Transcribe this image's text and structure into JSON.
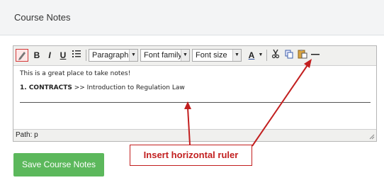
{
  "panel": {
    "title": "Course Notes"
  },
  "toolbar": {
    "bold": "B",
    "italic": "I",
    "underline": "U",
    "format_select": "Paragraph",
    "font_family_select": "Font family",
    "font_size_select": "Font size",
    "font_color_letter": "A"
  },
  "content": {
    "line1": "This is a great place to take notes!",
    "line2_bold": "1. CONTRACTS",
    "line2_rest": " >> Introduction to Regulation Law"
  },
  "statusbar": {
    "path": "Path: p"
  },
  "save_label": "Save Course Notes",
  "callout": {
    "text": "Insert horizontal ruler"
  },
  "colors": {
    "accent_green": "#5cb85c",
    "callout_red": "#c21f1f"
  }
}
